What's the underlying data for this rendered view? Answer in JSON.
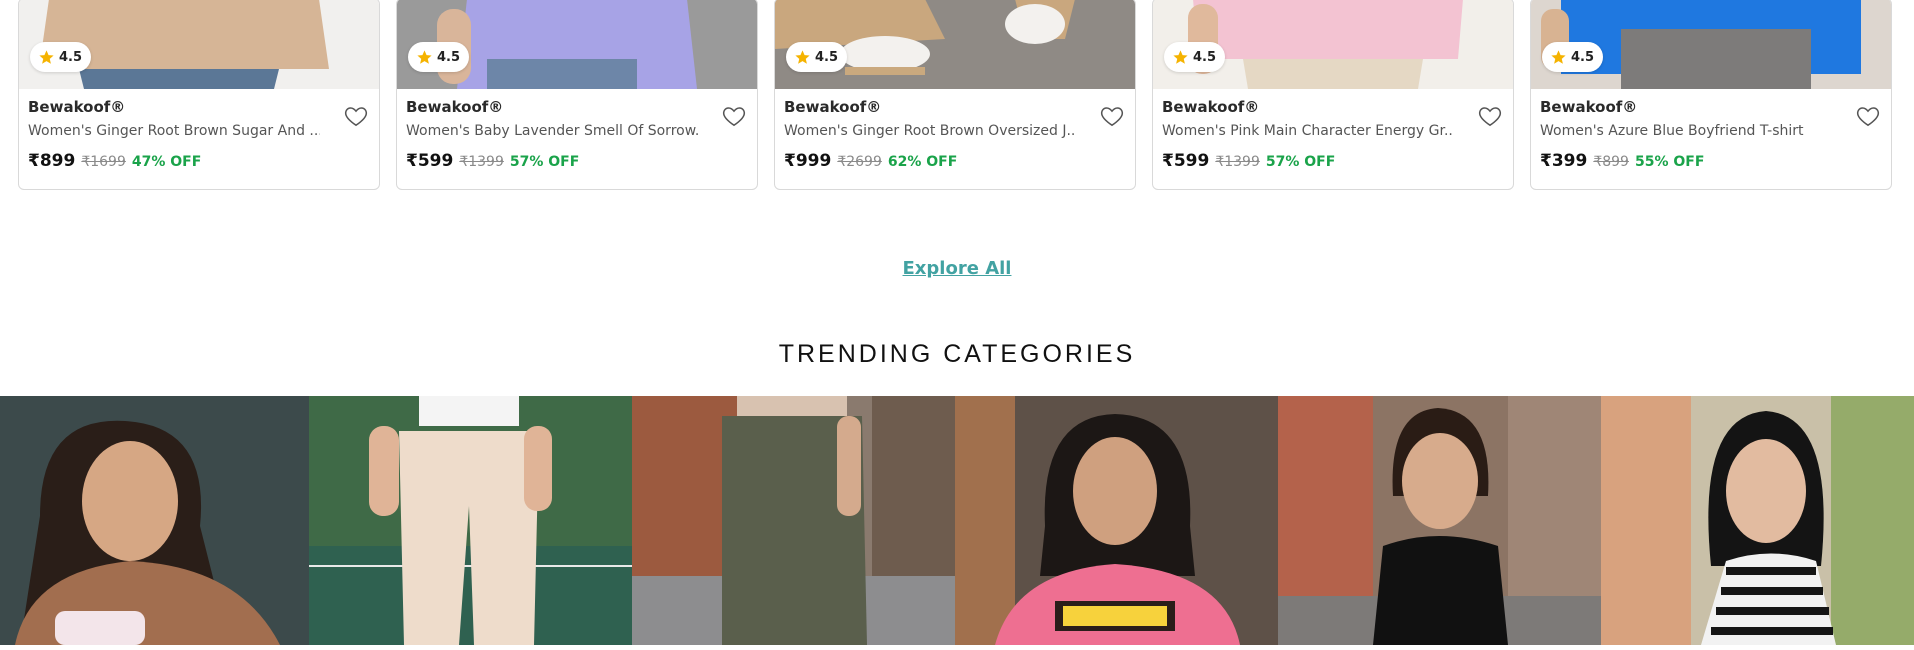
{
  "products": [
    {
      "rating": "4.5",
      "brand": "Bewakoof®",
      "name": "Women's Ginger Root Brown Sugar And ...",
      "price": "₹899",
      "mrp": "₹1699",
      "discount": "47% OFF"
    },
    {
      "rating": "4.5",
      "brand": "Bewakoof®",
      "name": "Women's Baby Lavender Smell Of Sorrow...",
      "price": "₹599",
      "mrp": "₹1399",
      "discount": "57% OFF"
    },
    {
      "rating": "4.5",
      "brand": "Bewakoof®",
      "name": "Women's Ginger Root Brown Oversized J...",
      "price": "₹999",
      "mrp": "₹2699",
      "discount": "62% OFF"
    },
    {
      "rating": "4.5",
      "brand": "Bewakoof®",
      "name": "Women's Pink Main Character Energy Gr...",
      "price": "₹599",
      "mrp": "₹1399",
      "discount": "57% OFF"
    },
    {
      "rating": "4.5",
      "brand": "Bewakoof®",
      "name": "Women's Azure Blue Boyfriend T-shirt",
      "price": "₹399",
      "mrp": "₹899",
      "discount": "55% OFF"
    }
  ],
  "explore_all": "Explore All",
  "trending": {
    "title": "TRENDING CATEGORIES",
    "tile_count": 6
  },
  "colors": {
    "accent": "#42a2a2",
    "discount": "#1aa34a",
    "star": "#f5b301"
  },
  "icons": {
    "rating": "star-icon",
    "wishlist": "heart-outline-icon"
  }
}
